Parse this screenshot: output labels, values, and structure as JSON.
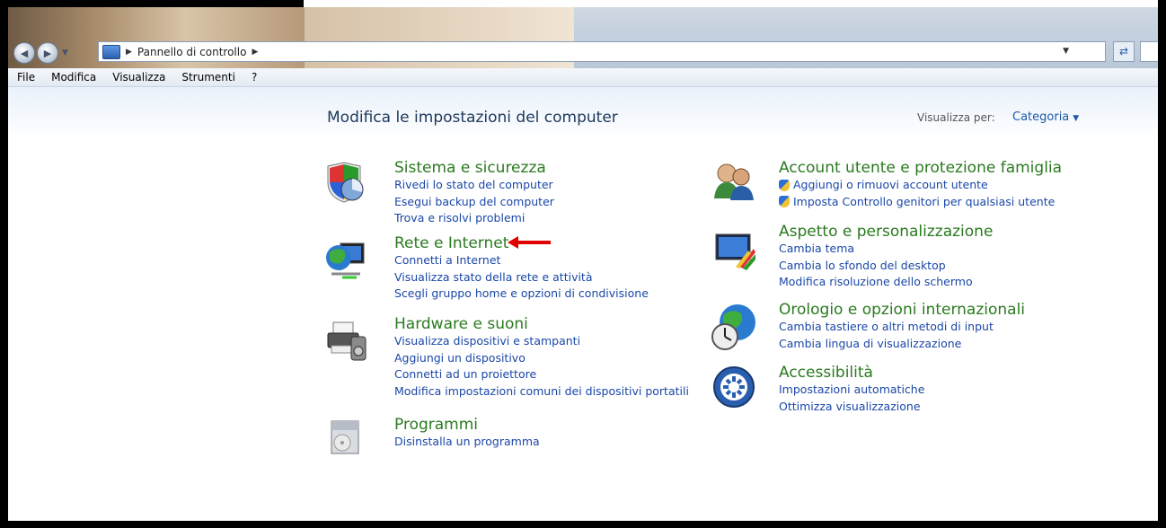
{
  "address_bar": {
    "breadcrumb": "Pannello di controllo"
  },
  "menu": [
    "File",
    "Modifica",
    "Visualizza",
    "Strumenti",
    "?"
  ],
  "heading": "Modifica le impostazioni del computer",
  "view_by": {
    "label": "Visualizza per:",
    "value": "Categoria"
  },
  "categories_left": [
    {
      "title": "Sistema e sicurezza",
      "icon": "shield-pie-icon",
      "links": [
        "Rivedi lo stato del computer",
        "Esegui backup del computer",
        "Trova e risolvi problemi"
      ]
    },
    {
      "title": "Rete e Internet",
      "icon": "globe-network-icon",
      "links": [
        "Connetti a Internet",
        "Visualizza stato della rete e attività",
        "Scegli gruppo home e opzioni di condivisione"
      ]
    },
    {
      "title": "Hardware e suoni",
      "icon": "printer-speaker-icon",
      "links": [
        "Visualizza dispositivi e stampanti",
        "Aggiungi un dispositivo",
        "Connetti ad un proiettore",
        "Modifica impostazioni comuni dei dispositivi portatili"
      ]
    },
    {
      "title": "Programmi",
      "icon": "programs-box-icon",
      "links": [
        "Disinstalla un programma"
      ]
    }
  ],
  "categories_right": [
    {
      "title": "Account utente e protezione famiglia",
      "icon": "users-icon",
      "links": [
        "Aggiungi o rimuovi account utente",
        "Imposta Controllo genitori per qualsiasi utente"
      ]
    },
    {
      "title": "Aspetto e personalizzazione",
      "icon": "monitor-paint-icon",
      "links": [
        "Cambia tema",
        "Cambia lo sfondo del desktop",
        "Modifica risoluzione dello schermo"
      ]
    },
    {
      "title": "Orologio e opzioni internazionali",
      "icon": "globe-clock-icon",
      "links": [
        "Cambia tastiere o altri metodi di input",
        "Cambia lingua di visualizzazione"
      ]
    },
    {
      "title": "Accessibilità",
      "icon": "accessibility-icon",
      "links": [
        "Impostazioni automatiche",
        "Ottimizza visualizzazione"
      ]
    }
  ],
  "colors": {
    "category_title": "#2a7a1f",
    "link": "#1a47a8",
    "annotation_arrow": "#e00000"
  }
}
